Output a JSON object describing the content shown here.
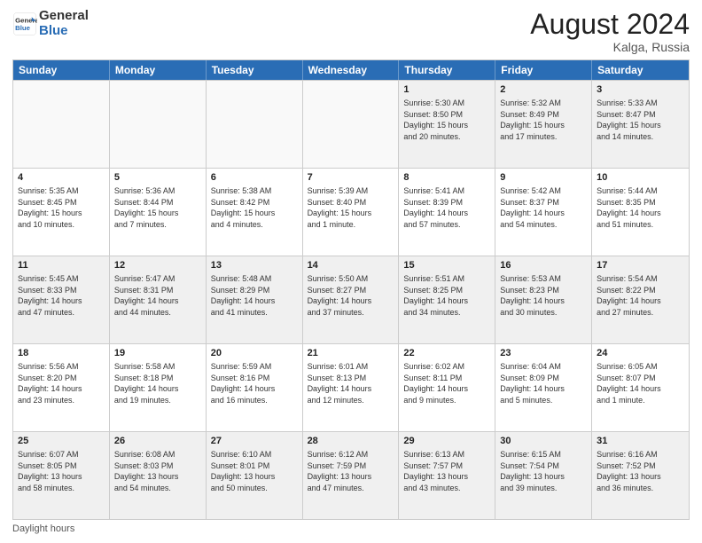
{
  "header": {
    "logo_line1": "General",
    "logo_line2": "Blue",
    "month_year": "August 2024",
    "location": "Kalga, Russia"
  },
  "days_of_week": [
    "Sunday",
    "Monday",
    "Tuesday",
    "Wednesday",
    "Thursday",
    "Friday",
    "Saturday"
  ],
  "footer_label": "Daylight hours",
  "weeks": [
    [
      {
        "day": "",
        "info": ""
      },
      {
        "day": "",
        "info": ""
      },
      {
        "day": "",
        "info": ""
      },
      {
        "day": "",
        "info": ""
      },
      {
        "day": "1",
        "info": "Sunrise: 5:30 AM\nSunset: 8:50 PM\nDaylight: 15 hours\nand 20 minutes."
      },
      {
        "day": "2",
        "info": "Sunrise: 5:32 AM\nSunset: 8:49 PM\nDaylight: 15 hours\nand 17 minutes."
      },
      {
        "day": "3",
        "info": "Sunrise: 5:33 AM\nSunset: 8:47 PM\nDaylight: 15 hours\nand 14 minutes."
      }
    ],
    [
      {
        "day": "4",
        "info": "Sunrise: 5:35 AM\nSunset: 8:45 PM\nDaylight: 15 hours\nand 10 minutes."
      },
      {
        "day": "5",
        "info": "Sunrise: 5:36 AM\nSunset: 8:44 PM\nDaylight: 15 hours\nand 7 minutes."
      },
      {
        "day": "6",
        "info": "Sunrise: 5:38 AM\nSunset: 8:42 PM\nDaylight: 15 hours\nand 4 minutes."
      },
      {
        "day": "7",
        "info": "Sunrise: 5:39 AM\nSunset: 8:40 PM\nDaylight: 15 hours\nand 1 minute."
      },
      {
        "day": "8",
        "info": "Sunrise: 5:41 AM\nSunset: 8:39 PM\nDaylight: 14 hours\nand 57 minutes."
      },
      {
        "day": "9",
        "info": "Sunrise: 5:42 AM\nSunset: 8:37 PM\nDaylight: 14 hours\nand 54 minutes."
      },
      {
        "day": "10",
        "info": "Sunrise: 5:44 AM\nSunset: 8:35 PM\nDaylight: 14 hours\nand 51 minutes."
      }
    ],
    [
      {
        "day": "11",
        "info": "Sunrise: 5:45 AM\nSunset: 8:33 PM\nDaylight: 14 hours\nand 47 minutes."
      },
      {
        "day": "12",
        "info": "Sunrise: 5:47 AM\nSunset: 8:31 PM\nDaylight: 14 hours\nand 44 minutes."
      },
      {
        "day": "13",
        "info": "Sunrise: 5:48 AM\nSunset: 8:29 PM\nDaylight: 14 hours\nand 41 minutes."
      },
      {
        "day": "14",
        "info": "Sunrise: 5:50 AM\nSunset: 8:27 PM\nDaylight: 14 hours\nand 37 minutes."
      },
      {
        "day": "15",
        "info": "Sunrise: 5:51 AM\nSunset: 8:25 PM\nDaylight: 14 hours\nand 34 minutes."
      },
      {
        "day": "16",
        "info": "Sunrise: 5:53 AM\nSunset: 8:23 PM\nDaylight: 14 hours\nand 30 minutes."
      },
      {
        "day": "17",
        "info": "Sunrise: 5:54 AM\nSunset: 8:22 PM\nDaylight: 14 hours\nand 27 minutes."
      }
    ],
    [
      {
        "day": "18",
        "info": "Sunrise: 5:56 AM\nSunset: 8:20 PM\nDaylight: 14 hours\nand 23 minutes."
      },
      {
        "day": "19",
        "info": "Sunrise: 5:58 AM\nSunset: 8:18 PM\nDaylight: 14 hours\nand 19 minutes."
      },
      {
        "day": "20",
        "info": "Sunrise: 5:59 AM\nSunset: 8:16 PM\nDaylight: 14 hours\nand 16 minutes."
      },
      {
        "day": "21",
        "info": "Sunrise: 6:01 AM\nSunset: 8:13 PM\nDaylight: 14 hours\nand 12 minutes."
      },
      {
        "day": "22",
        "info": "Sunrise: 6:02 AM\nSunset: 8:11 PM\nDaylight: 14 hours\nand 9 minutes."
      },
      {
        "day": "23",
        "info": "Sunrise: 6:04 AM\nSunset: 8:09 PM\nDaylight: 14 hours\nand 5 minutes."
      },
      {
        "day": "24",
        "info": "Sunrise: 6:05 AM\nSunset: 8:07 PM\nDaylight: 14 hours\nand 1 minute."
      }
    ],
    [
      {
        "day": "25",
        "info": "Sunrise: 6:07 AM\nSunset: 8:05 PM\nDaylight: 13 hours\nand 58 minutes."
      },
      {
        "day": "26",
        "info": "Sunrise: 6:08 AM\nSunset: 8:03 PM\nDaylight: 13 hours\nand 54 minutes."
      },
      {
        "day": "27",
        "info": "Sunrise: 6:10 AM\nSunset: 8:01 PM\nDaylight: 13 hours\nand 50 minutes."
      },
      {
        "day": "28",
        "info": "Sunrise: 6:12 AM\nSunset: 7:59 PM\nDaylight: 13 hours\nand 47 minutes."
      },
      {
        "day": "29",
        "info": "Sunrise: 6:13 AM\nSunset: 7:57 PM\nDaylight: 13 hours\nand 43 minutes."
      },
      {
        "day": "30",
        "info": "Sunrise: 6:15 AM\nSunset: 7:54 PM\nDaylight: 13 hours\nand 39 minutes."
      },
      {
        "day": "31",
        "info": "Sunrise: 6:16 AM\nSunset: 7:52 PM\nDaylight: 13 hours\nand 36 minutes."
      }
    ]
  ]
}
